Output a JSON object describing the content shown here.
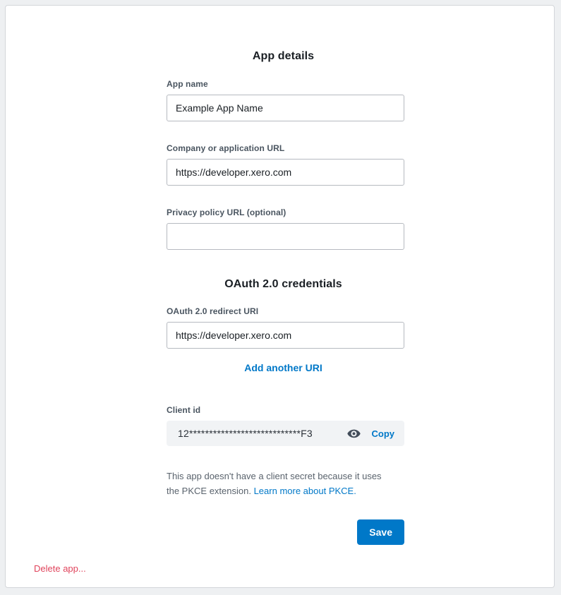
{
  "card": {
    "sections": {
      "app_details_title": "App details",
      "oauth_title": "OAuth 2.0 credentials"
    },
    "fields": {
      "app_name": {
        "label": "App name",
        "value": "Example App Name",
        "placeholder": ""
      },
      "company_url": {
        "label": "Company or application URL",
        "value": "https://developer.xero.com",
        "placeholder": ""
      },
      "privacy_url": {
        "label": "Privacy policy URL (optional)",
        "value": "",
        "placeholder": ""
      },
      "redirect_uri": {
        "label": "OAuth 2.0 redirect URI",
        "value": "https://developer.xero.com",
        "placeholder": ""
      },
      "client_id": {
        "label": "Client id",
        "value": "12****************************F3"
      }
    },
    "links": {
      "add_another_uri": "Add another URI",
      "copy": "Copy",
      "learn_more_pkce": "Learn more about PKCE."
    },
    "icons": {
      "show_client_id": "eye-icon"
    },
    "notes": {
      "pkce_prefix": "This app doesn't have a client secret because it uses the PKCE extension. "
    },
    "buttons": {
      "save": "Save",
      "delete_app": "Delete app..."
    },
    "colors": {
      "accent": "#0078c8",
      "danger": "#e0445c",
      "label": "#4a5560",
      "field_background": "#f1f3f5"
    }
  }
}
